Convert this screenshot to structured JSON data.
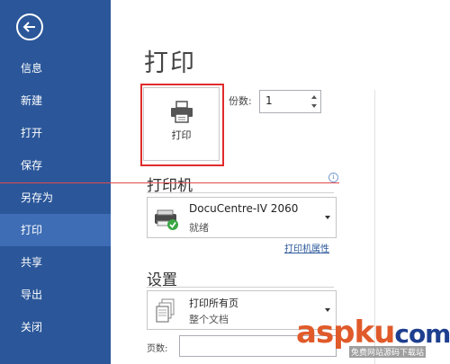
{
  "sidebar": {
    "items": [
      {
        "label": "信息"
      },
      {
        "label": "新建"
      },
      {
        "label": "打开"
      },
      {
        "label": "保存"
      },
      {
        "label": "另存为"
      },
      {
        "label": "打印"
      },
      {
        "label": "共享"
      },
      {
        "label": "导出"
      },
      {
        "label": "关闭"
      }
    ],
    "active": "打印"
  },
  "main": {
    "title": "打印",
    "print_button_label": "打印",
    "copies_label": "份数:",
    "copies_value": "1",
    "printer_heading": "打印机",
    "printer": {
      "name": "DocuCentre-IV 2060",
      "status": "就绪"
    },
    "printer_properties_link": "打印机属性",
    "settings_heading": "设置",
    "print_range": {
      "main": "打印所有页",
      "sub": "整个文档"
    },
    "pages_label": "页数:",
    "pages_value": ""
  },
  "watermark": {
    "brand": "aspku",
    "tail": "com",
    "sub": "免费网站源码下载站"
  },
  "colors": {
    "sidebar_bg": "#2b579a",
    "sidebar_active": "#3e6db5",
    "highlight": "#e02c2c"
  }
}
